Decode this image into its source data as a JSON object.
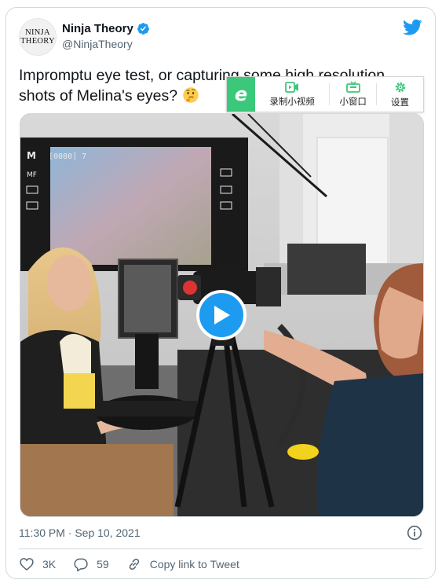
{
  "author": {
    "avatar_line1": "NINJA",
    "avatar_line2": "THEORY",
    "display_name": "Ninja Theory",
    "handle": "@NinjaTheory",
    "verified": true
  },
  "tweet": {
    "text": "Impromptu eye test, or capturing some high resolution shots of Melina's eyes?",
    "emoji": "thinking-face",
    "timestamp": "11:30 PM · Sep 10, 2021"
  },
  "overlay_toolbar": {
    "logo_letter": "e",
    "record_label": "录制小视频",
    "mini_window_label": "小窗口",
    "settings_label": "设置",
    "accent_color": "#3cc87a"
  },
  "media": {
    "type": "video",
    "camera_screen_text": "1/250  F4.0  ISO100"
  },
  "actions": {
    "likes": "3K",
    "replies": "59",
    "copy_link_label": "Copy link to Tweet"
  },
  "colors": {
    "twitter_blue": "#1d9bf0",
    "text_primary": "#0f1419",
    "text_secondary": "#536471",
    "border": "#cfd9de"
  }
}
